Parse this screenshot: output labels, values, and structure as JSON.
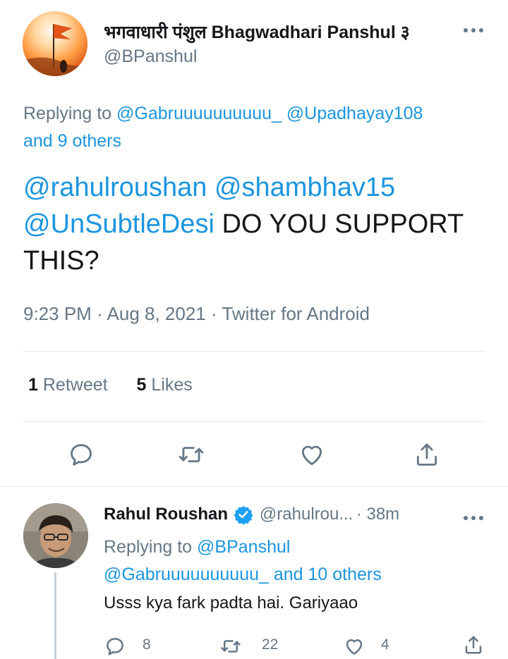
{
  "main_tweet": {
    "author_name": "भगवाधारी पंशुल Bhagwadhari Panshul",
    "author_name_overflow": "३",
    "handle": "@BPanshul",
    "replying_label": "Replying to",
    "replying_users": [
      "@Gabruuuuuuuuuu_",
      "@Upadhayay108"
    ],
    "replying_others": "and 9 others",
    "mentions": [
      "@rahulroushan",
      "@shambhav15",
      "@UnSubtleDesi"
    ],
    "text": "DO YOU SUPPORT THIS?",
    "time": "9:23 PM",
    "date": "Aug 8, 2021",
    "source": "Twitter for Android",
    "retweets_count": "1",
    "retweets_label": "Retweet",
    "likes_count": "5",
    "likes_label": "Likes",
    "actions": [
      "reply-icon",
      "retweet-icon",
      "like-icon",
      "share-icon"
    ]
  },
  "reply_tweet": {
    "author_name": "Rahul Roushan",
    "handle": "@rahulrou...",
    "time": "38m",
    "replying_label": "Replying to",
    "replying_user": "@BPanshul",
    "replying_user_2": "@Gabruuuuuuuuuu_",
    "replying_others": "and 10 others",
    "text": "Usss kya fark padta hai. Gariyaao",
    "reply_count": "8",
    "retweet_count": "22",
    "like_count": "4"
  },
  "colors": {
    "accent": "#1b95e0",
    "secondary_text": "#657786",
    "primary_text": "#14171a",
    "divider": "#e1e8ed"
  }
}
